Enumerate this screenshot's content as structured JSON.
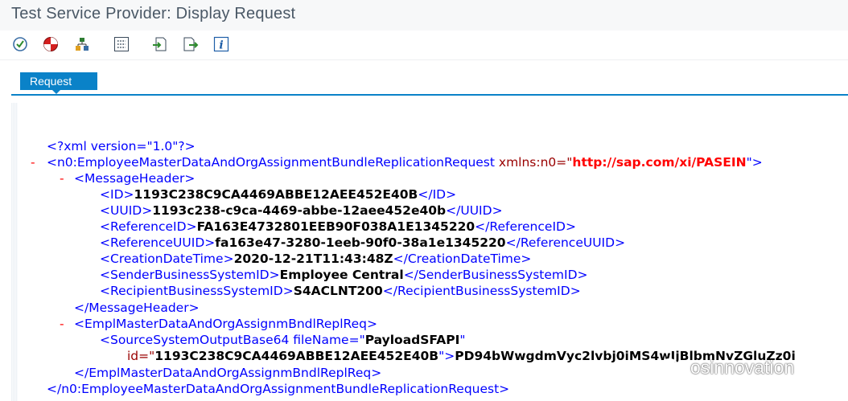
{
  "window": {
    "title": "Test Service Provider: Display Request"
  },
  "toolbar": {
    "buttons": [
      {
        "icon": "check-icon"
      },
      {
        "icon": "exit-icon"
      },
      {
        "icon": "hierarchy-icon"
      },
      {
        "icon": "grid-icon"
      },
      {
        "icon": "import-icon"
      },
      {
        "icon": "export-icon"
      },
      {
        "icon": "info-icon"
      }
    ]
  },
  "tabs": [
    {
      "label": "Request"
    }
  ],
  "xml": {
    "decl": "<?xml version=\"1.0\"?>",
    "root_open_tag": "<n0:EmployeeMasterDataAndOrgAssignmentBundleReplicationRequest ",
    "root_ns_attr": "xmlns:n0=\"",
    "root_ns_value": "http://sap.com/xi/PASEIN",
    "root_ns_close": "\">",
    "msg_header_open": "<MessageHeader>",
    "fields": [
      {
        "tag": "ID",
        "value": "1193C238C9CA4469ABBE12AEE452E40B"
      },
      {
        "tag": "UUID",
        "value": "1193c238-c9ca-4469-abbe-12aee452e40b"
      },
      {
        "tag": "ReferenceID",
        "value": "FA163E4732801EEB90F038A1E1345220"
      },
      {
        "tag": "ReferenceUUID",
        "value": "fa163e47-3280-1eeb-90f0-38a1e1345220"
      },
      {
        "tag": "CreationDateTime",
        "value": "2020-12-21T11:43:48Z"
      },
      {
        "tag": "SenderBusinessSystemID",
        "value": "Employee Central"
      },
      {
        "tag": "RecipientBusinessSystemID",
        "value": "S4ACLNT200"
      }
    ],
    "msg_header_close": "</MessageHeader>",
    "bundle_open": "<EmplMasterDataAndOrgAssignmBndlReplReq>",
    "source_tag_start": "<SourceSystemOutputBase64 fileName=\"",
    "file_name": "PayloadSFAPI",
    "quote": "\"",
    "id_attr": "id=\"",
    "id_value": "1193C238C9CA4469ABBE12AEE452E40B",
    "id_close": "\">",
    "payload": "PD94bWwgdmVyc2lvbj0iMS4wIjBlbmNvZGluZz0i",
    "bundle_close": "</EmplMasterDataAndOrgAssignmBndlReplReq>",
    "root_close": "</n0:EmployeeMasterDataAndOrgAssignmentBundleReplicationRequest>"
  },
  "collapse_marker": "-",
  "watermark": {
    "text": "osinnovation"
  }
}
